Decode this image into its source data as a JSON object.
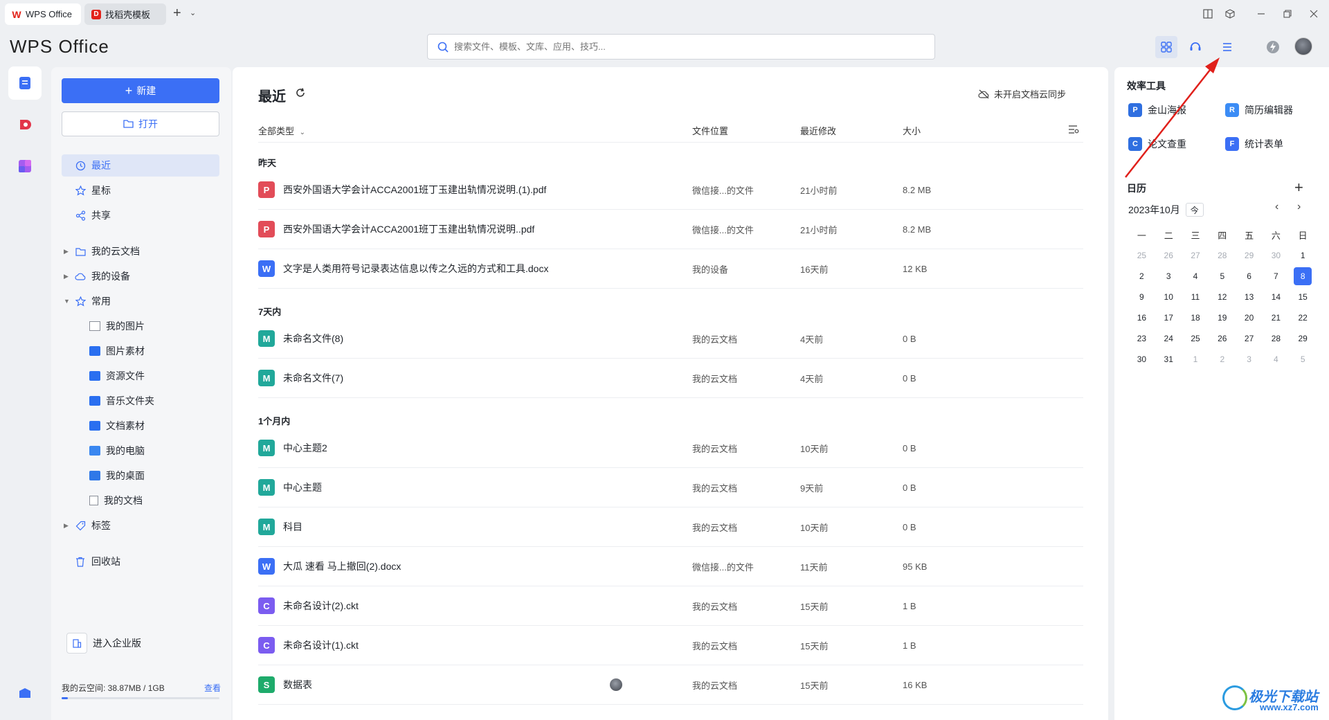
{
  "tabs": [
    {
      "label": "WPS Office"
    },
    {
      "label": "找稻壳模板"
    }
  ],
  "app": {
    "logo": "WPS Office"
  },
  "search": {
    "placeholder": "搜索文件、模板、文库、应用、技巧..."
  },
  "sidebar": {
    "new_label": "新建",
    "open_label": "打开",
    "nav": [
      {
        "label": "最近",
        "active": true
      },
      {
        "label": "星标"
      },
      {
        "label": "共享"
      },
      {
        "label": "我的云文档"
      },
      {
        "label": "我的设备"
      },
      {
        "label": "常用"
      }
    ],
    "common_items": [
      {
        "label": "我的图片"
      },
      {
        "label": "图片素材"
      },
      {
        "label": "资源文件"
      },
      {
        "label": "音乐文件夹"
      },
      {
        "label": "文档素材"
      },
      {
        "label": "我的电脑"
      },
      {
        "label": "我的桌面"
      },
      {
        "label": "我的文档"
      }
    ],
    "tags_label": "标签",
    "recycle_label": "回收站",
    "enterprise_label": "进入企业版",
    "cloud_space_label": "我的云空间: 38.87MB / 1GB",
    "cloud_space_view": "查看",
    "cloud_space_used_fraction": 0.038
  },
  "main": {
    "title": "最近",
    "sync_label": "未开启文档云同步",
    "columns": {
      "type_filter": "全部类型",
      "location": "文件位置",
      "modified": "最近修改",
      "size": "大小"
    },
    "groups": [
      {
        "label": "昨天",
        "files": [
          {
            "type": "pdf",
            "name": "西安外国语大学会计ACCA2001班丁玉建出轨情况说明.(1).pdf",
            "location": "微信接...的文件",
            "modified": "21小时前",
            "size": "8.2 MB"
          },
          {
            "type": "pdf",
            "name": "西安外国语大学会计ACCA2001班丁玉建出轨情况说明..pdf",
            "location": "微信接...的文件",
            "modified": "21小时前",
            "size": "8.2 MB"
          },
          {
            "type": "doc",
            "name": "文字是人类用符号记录表达信息以传之久远的方式和工具.docx",
            "location": "我的设备",
            "modified": "16天前",
            "size": "12 KB"
          }
        ]
      },
      {
        "label": "7天内",
        "files": [
          {
            "type": "mind",
            "name": "未命名文件(8)",
            "location": "我的云文档",
            "modified": "4天前",
            "size": "0 B"
          },
          {
            "type": "mind",
            "name": "未命名文件(7)",
            "location": "我的云文档",
            "modified": "4天前",
            "size": "0 B"
          }
        ]
      },
      {
        "label": "1个月内",
        "files": [
          {
            "type": "mind",
            "name": "中心主题2",
            "location": "我的云文档",
            "modified": "10天前",
            "size": "0 B"
          },
          {
            "type": "mind",
            "name": "中心主题",
            "location": "我的云文档",
            "modified": "9天前",
            "size": "0 B"
          },
          {
            "type": "mind",
            "name": "科目",
            "location": "我的云文档",
            "modified": "10天前",
            "size": "0 B"
          },
          {
            "type": "doc",
            "name": "大瓜 速看 马上撤回(2).docx",
            "location": "微信接...的文件",
            "modified": "11天前",
            "size": "95 KB"
          },
          {
            "type": "ckt",
            "name": "未命名设计(2).ckt",
            "location": "我的云文档",
            "modified": "15天前",
            "size": "1 B"
          },
          {
            "type": "ckt",
            "name": "未命名设计(1).ckt",
            "location": "我的云文档",
            "modified": "15天前",
            "size": "1 B"
          },
          {
            "type": "sheet",
            "name": "数据表",
            "location": "我的云文档",
            "modified": "15天前",
            "size": "16 KB"
          }
        ]
      }
    ]
  },
  "right_panel": {
    "tools_title": "效率工具",
    "tools": [
      {
        "label": "金山海报",
        "color": "#2f6fe0"
      },
      {
        "label": "简历编辑器",
        "color": "#3b8cf5"
      },
      {
        "label": "论文查重",
        "color": "#2f6fe0"
      },
      {
        "label": "统计表单",
        "color": "#3b6ff5"
      }
    ],
    "calendar_title": "日历",
    "calendar_month": "2023年10月",
    "today_label": "今",
    "weekdays": [
      "一",
      "二",
      "三",
      "四",
      "五",
      "六",
      "日"
    ],
    "weeks": [
      [
        "25",
        "26",
        "27",
        "28",
        "29",
        "30",
        "1"
      ],
      [
        "2",
        "3",
        "4",
        "5",
        "6",
        "7",
        "8"
      ],
      [
        "9",
        "10",
        "11",
        "12",
        "13",
        "14",
        "15"
      ],
      [
        "16",
        "17",
        "18",
        "19",
        "20",
        "21",
        "22"
      ],
      [
        "23",
        "24",
        "25",
        "26",
        "27",
        "28",
        "29"
      ],
      [
        "30",
        "31",
        "1",
        "2",
        "3",
        "4",
        "5"
      ]
    ],
    "today": "8"
  },
  "watermark": {
    "text": "极光下载站",
    "url": "www.xz7.com"
  },
  "colors": {
    "accent": "#3b6ff5",
    "annotation": "#e0201b"
  }
}
